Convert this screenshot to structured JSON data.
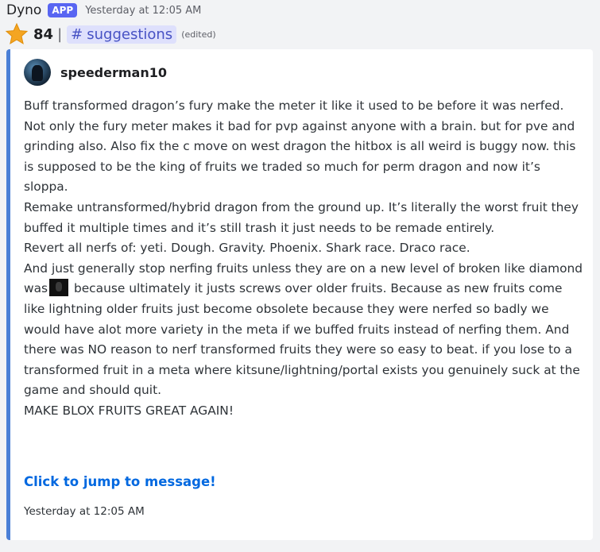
{
  "message": {
    "author": "Dyno",
    "badge": "APP",
    "timestamp": "Yesterday at 12:05 AM",
    "star_count": "84",
    "separator": "|",
    "channel_hash": "#",
    "channel_name": "suggestions",
    "edited": "(edited)"
  },
  "embed": {
    "accent_color": "#4a7fd6",
    "author_name": "speederman10",
    "paragraphs": [
      "Buff transformed dragon’s fury make the meter it like it used to be before it was nerfed. Not only the fury meter makes it bad for pvp against anyone with a brain. but for pve and grinding also. Also fix the c move on west dragon the hitbox is all weird is buggy now. this is supposed to be the king of fruits we traded so much for perm dragon and now it’s sloppa.",
      "Remake untransformed/hybrid dragon from the ground up. It’s literally the worst fruit they buffed it multiple times and it’s still trash it just needs to be remade entirely.",
      "Revert all nerfs of: yeti. Dough. Gravity. Phoenix. Shark race. Draco race."
    ],
    "last_paragraph_before": "And just generally stop nerfing fruits unless they are on a new level of broken like diamond was",
    "last_paragraph_after": " because ultimately it justs screws over older fruits. Because as new fruits come like lightning older fruits just become obsolete because they were nerfed so badly we would have alot more variety in the meta if we buffed fruits instead of nerfing them. And there was NO reason to nerf transformed fruits they were so easy to beat. if you lose to a transformed fruit in a meta where kitsune/lightning/portal exists you genuinely suck at the game and should quit.",
    "closing_line": "MAKE BLOX FRUITS GREAT AGAIN!",
    "jump_link": "Click to jump to message!",
    "footer_timestamp": "Yesterday at 12:05 AM"
  },
  "icons": {
    "star": "star-icon",
    "avatar": "avatar",
    "emoji": "custom-emoji-icon"
  },
  "colors": {
    "app_badge": "#5865f2",
    "channel_mention_bg": "#dee0fc",
    "channel_mention_text": "#4752c4",
    "link": "#0068e0"
  }
}
